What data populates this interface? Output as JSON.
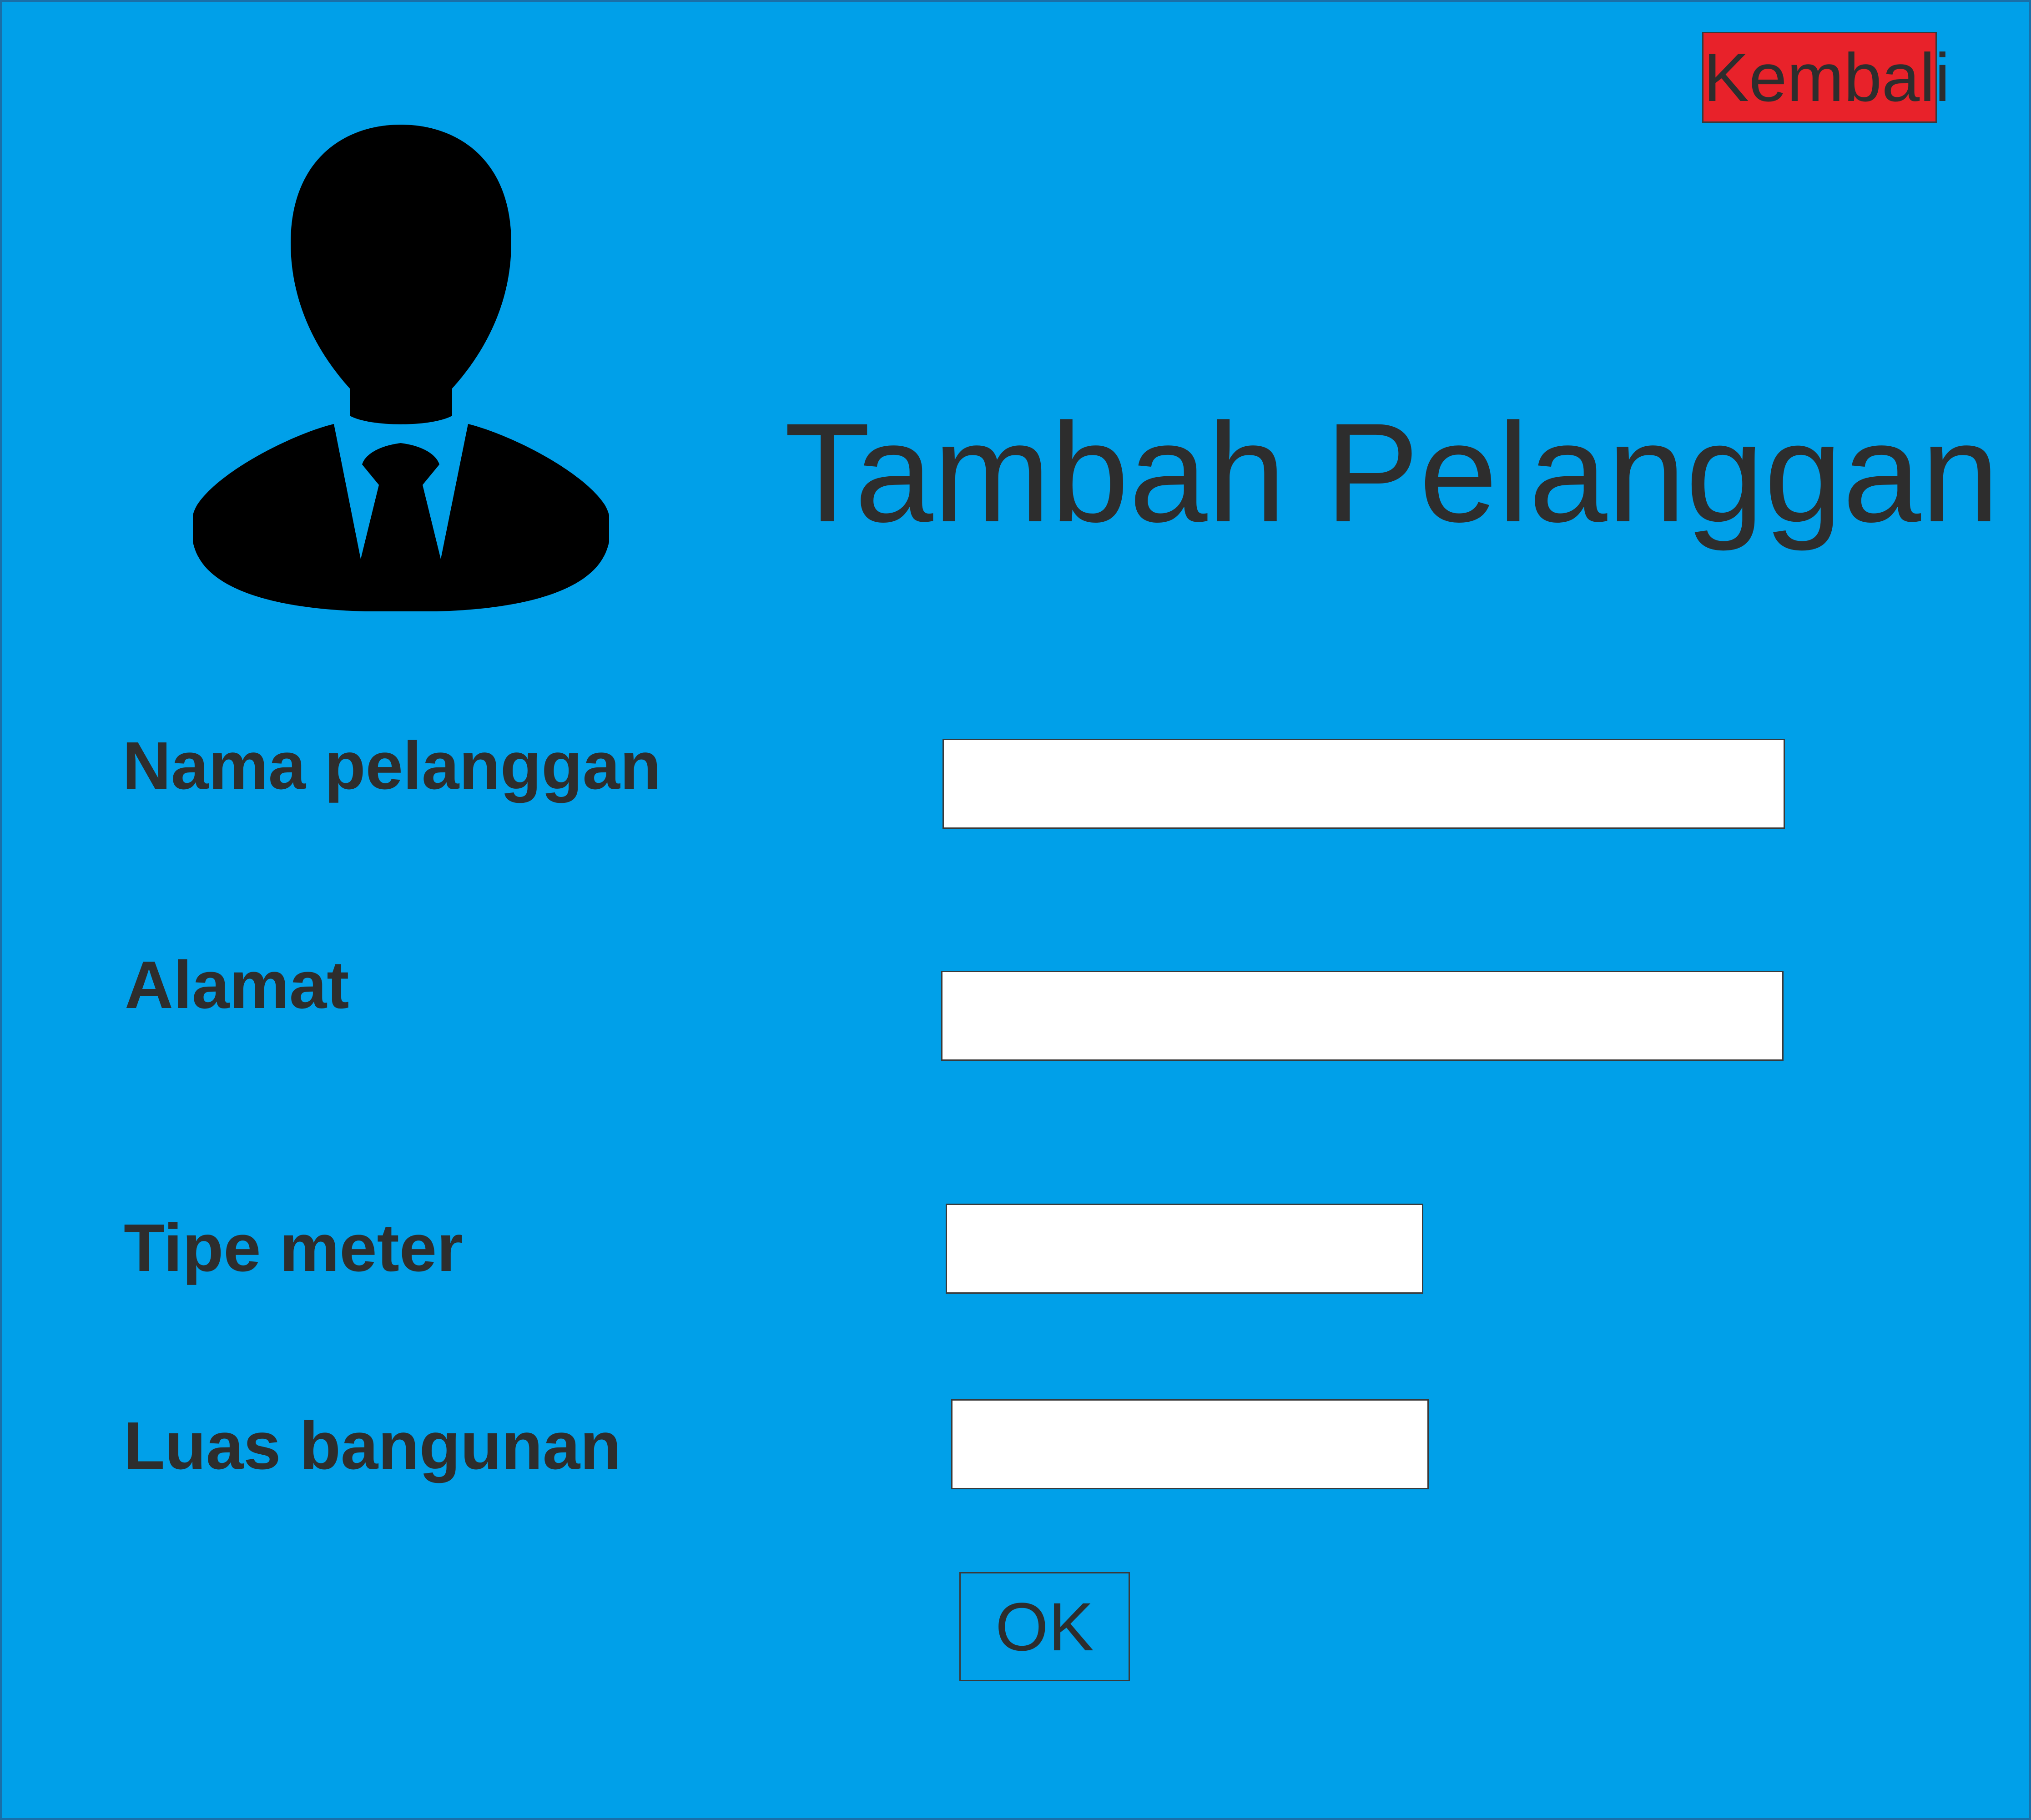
{
  "colors": {
    "background": "#00a0e9",
    "back_button": "#e8222a",
    "text": "#2d2d2d",
    "input_background": "#ffffff"
  },
  "header": {
    "back_label": "Kembali",
    "title": "Tambah Pelanggan",
    "avatar_icon": "user-suit-icon"
  },
  "form": {
    "fields": [
      {
        "label": "Nama pelanggan",
        "value": ""
      },
      {
        "label": "Alamat",
        "value": ""
      },
      {
        "label": "Tipe meter",
        "value": ""
      },
      {
        "label": "Luas bangunan",
        "value": ""
      }
    ],
    "submit_label": "OK"
  }
}
